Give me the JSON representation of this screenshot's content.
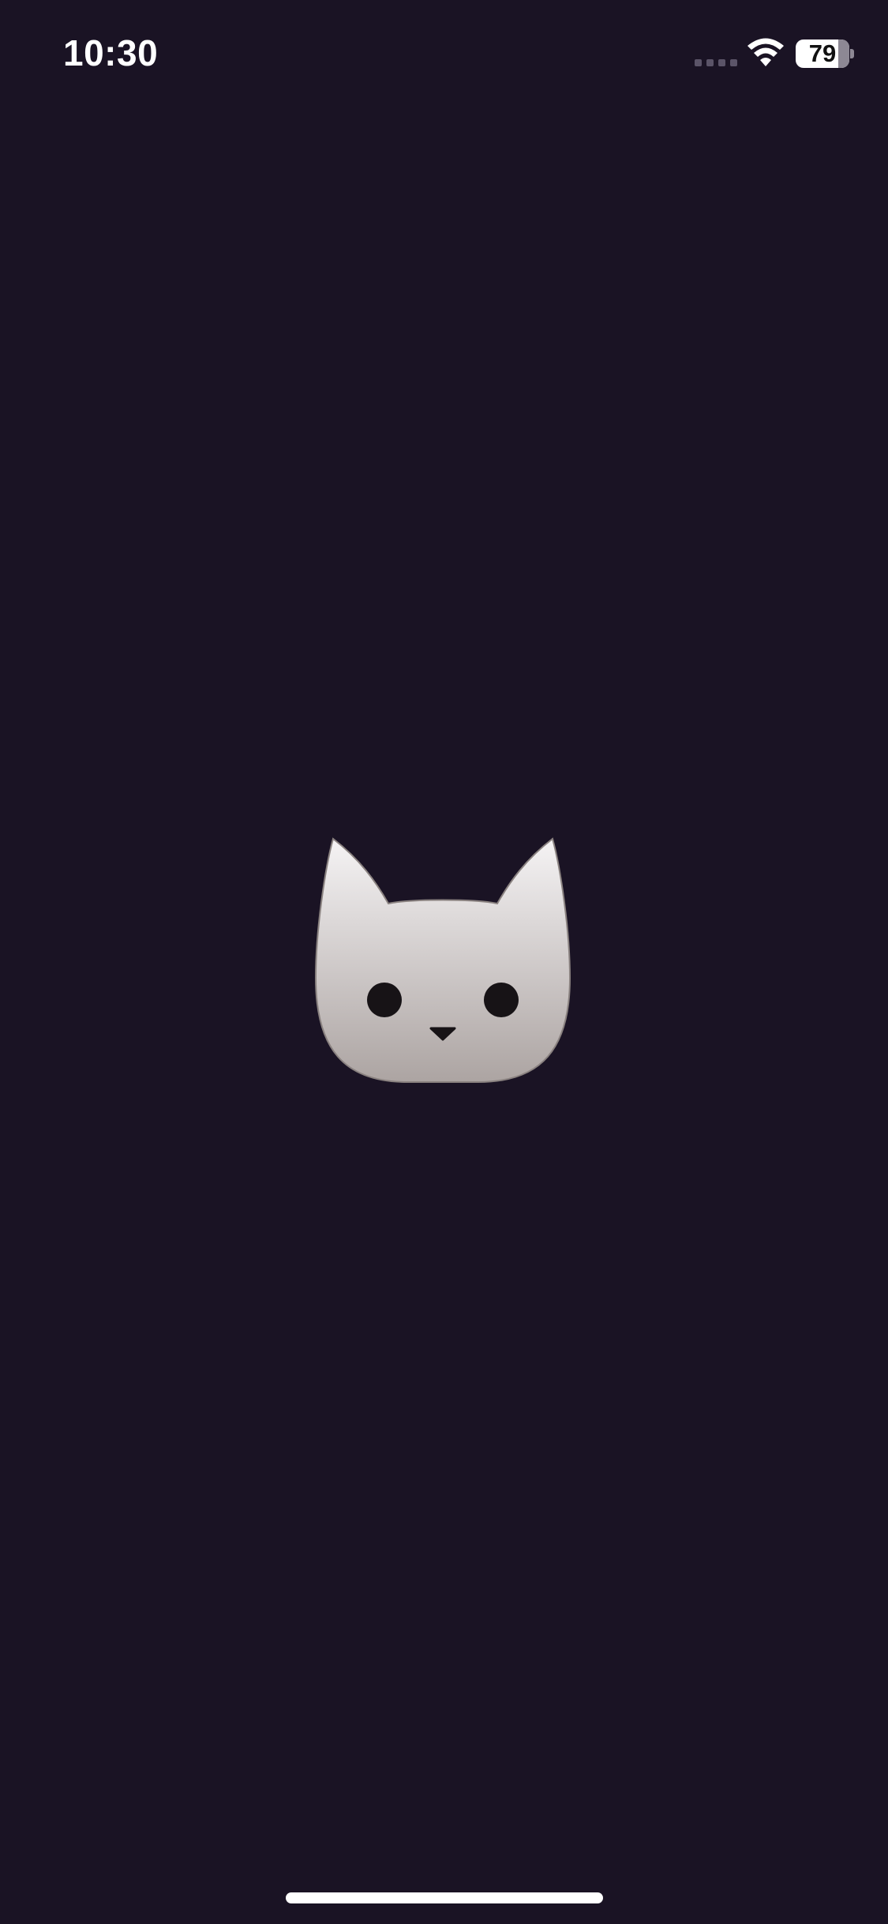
{
  "status_bar": {
    "time": "10:30",
    "battery_percent": 79,
    "battery_label": "79",
    "signal_icon": "cellular-signal-icon",
    "wifi_icon": "wifi-icon",
    "battery_icon": "battery-icon"
  },
  "splash": {
    "logo_icon": "cat-head-icon"
  },
  "colors": {
    "background": "#1a1324",
    "logo_light": "#f1eff0",
    "logo_dark": "#b2aaa8",
    "status_foreground": "#ffffff"
  }
}
